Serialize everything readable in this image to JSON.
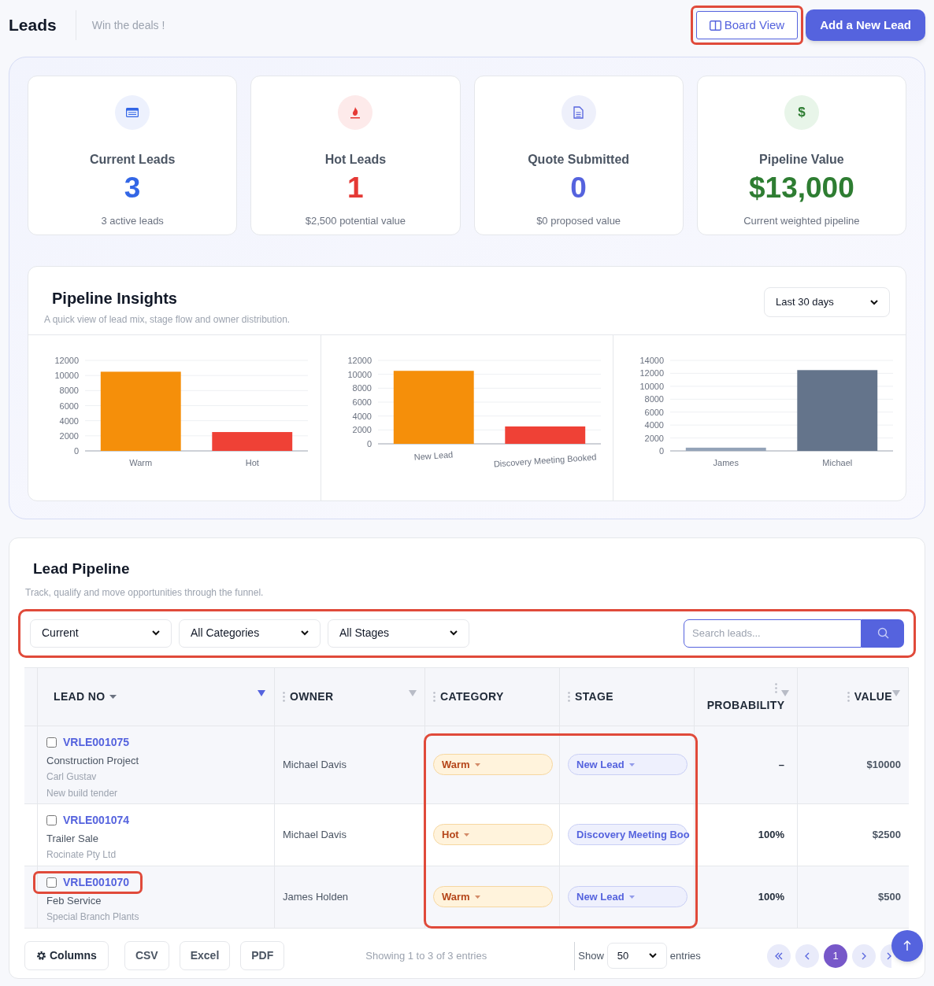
{
  "header": {
    "title": "Leads",
    "subtitle": "Win the deals !",
    "board_view": {
      "label": "Board View",
      "highlighted": true
    },
    "add_button": "Add a New Lead"
  },
  "stats": [
    {
      "kind": "list",
      "title": "Current Leads",
      "value": "3",
      "note": "3 active leads",
      "color": "#3366e6"
    },
    {
      "kind": "fire",
      "title": "Hot Leads",
      "value": "1",
      "note": "$2,500 potential value",
      "color": "#e53935"
    },
    {
      "kind": "document",
      "title": "Quote Submitted",
      "value": "0",
      "note": "$0 proposed value",
      "color": "#5563de"
    },
    {
      "kind": "dollar",
      "icon": "$",
      "title": "Pipeline Value",
      "value": "$13,000",
      "note": "Current weighted pipeline",
      "color": "#2e7d32"
    }
  ],
  "insights": {
    "title": "Pipeline Insights",
    "subtitle": "A quick view of lead mix, stage flow and owner distribution.",
    "period": "Last 30 days",
    "charts": [
      {
        "chart_data": {
          "type": "bar",
          "grid": true,
          "categories": [
            "Warm",
            "Hot"
          ],
          "series": [
            {
              "color": "#f58f0a",
              "values": [
                10500,
                null
              ]
            },
            {
              "color": "#ef4136",
              "values": [
                null,
                2500
              ]
            }
          ],
          "ylim": [
            0,
            12000
          ],
          "yticks": [
            0,
            2000,
            4000,
            6000,
            8000,
            10000,
            12000
          ]
        }
      },
      {
        "chart_data": {
          "type": "bar",
          "grid": true,
          "categories": [
            "New Lead",
            "Discovery Meeting Booked"
          ],
          "series": [
            {
              "color": "#f58f0a",
              "values": [
                10500,
                null
              ]
            },
            {
              "color": "#ef4136",
              "values": [
                null,
                2500
              ]
            }
          ],
          "ylim": [
            0,
            12000
          ],
          "yticks": [
            0,
            2000,
            4000,
            6000,
            8000,
            10000,
            12000
          ]
        }
      },
      {
        "chart_data": {
          "type": "bar",
          "grid": true,
          "categories": [
            "James",
            "Michael"
          ],
          "series": [
            {
              "color": "#94a3b8",
              "values": [
                500,
                null
              ]
            },
            {
              "color": "#64748b",
              "values": [
                null,
                12500
              ]
            }
          ],
          "ylim": [
            0,
            14000
          ],
          "yticks": [
            0,
            2000,
            4000,
            6000,
            8000,
            10000,
            12000,
            14000
          ]
        }
      }
    ]
  },
  "pipeline": {
    "title": "Lead Pipeline",
    "subtitle": "Track, qualify and move opportunities through the funnel.",
    "filters": {
      "highlighted": true,
      "selects": [
        "Current",
        "All Categories",
        "All Stages"
      ],
      "search_placeholder": "Search leads..."
    },
    "columns": [
      "LEAD NO",
      "OWNER",
      "CATEGORY",
      "STAGE",
      "PROBABILITY",
      "VALUE"
    ],
    "highlight_category_stage": true,
    "rows": [
      {
        "lead_no": "VRLE001075",
        "checked": false,
        "highlighted": false,
        "project": "Construction Project",
        "contact": "Carl Gustav",
        "note": "New build tender",
        "owner": "Michael Davis",
        "category": "Warm",
        "stage": "New Lead",
        "probability": "–",
        "value": "$10000"
      },
      {
        "lead_no": "VRLE001074",
        "checked": false,
        "highlighted": false,
        "project": "Trailer Sale",
        "contact": "Rocinate Pty Ltd",
        "owner": "Michael Davis",
        "category": "Hot",
        "stage": "Discovery Meeting Boo",
        "probability": "100%",
        "value": "$2500"
      },
      {
        "lead_no": "VRLE001070",
        "checked": false,
        "highlighted": true,
        "project": "Feb Service",
        "contact": "Special Branch Plants",
        "owner": "James Holden",
        "category": "Warm",
        "stage": "New Lead",
        "probability": "100%",
        "value": "$500"
      }
    ],
    "footer": {
      "buttons": [
        "Columns",
        "CSV",
        "Excel",
        "PDF"
      ],
      "info": "Showing 1 to 3 of 3 entries",
      "show": "Show",
      "page_size": "50",
      "entries": "entries",
      "current_page": "1"
    }
  }
}
